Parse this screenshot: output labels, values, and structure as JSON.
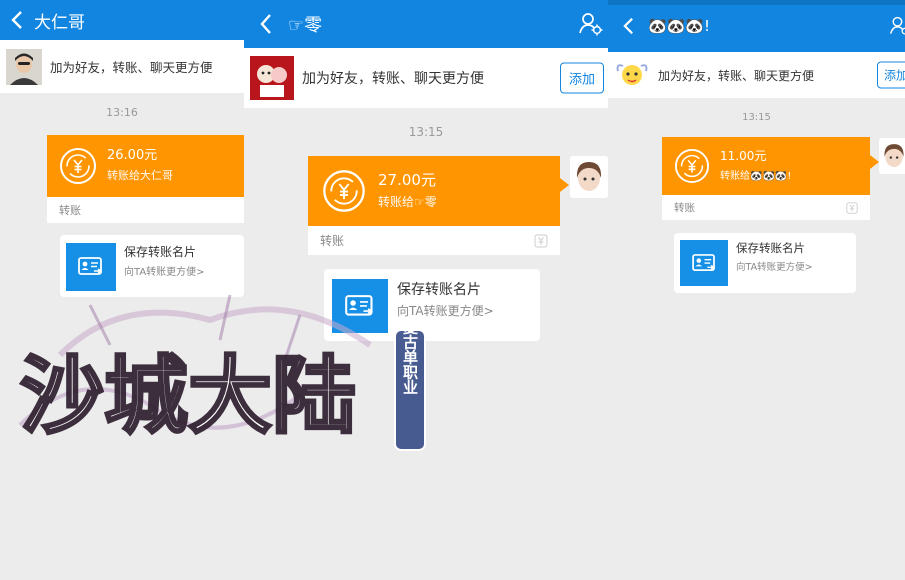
{
  "panels": [
    {
      "title": "大仁哥",
      "friend_prompt": "加为好友，转账、聊天更方便",
      "time": "13:16",
      "transfer": {
        "amount": "26.00元",
        "to": "转账给大仁哥",
        "label": "转账"
      },
      "save_card": {
        "title": "保存转账名片",
        "subtitle": "向TA转账更方便>"
      }
    },
    {
      "title": "☞零",
      "friend_prompt": "加为好友，转账、聊天更方便",
      "add_label": "添加",
      "time": "13:15",
      "transfer": {
        "amount": "27.00元",
        "to": "转账给☞零",
        "label": "转账"
      },
      "save_card": {
        "title": "保存转账名片",
        "subtitle": "向TA转账更方便>"
      }
    },
    {
      "title": "🐼🐼🐼!",
      "friend_prompt": "加为好友，转账、聊天更方便",
      "add_label": "添加",
      "time": "13:15",
      "transfer": {
        "amount": "11.00元",
        "to": "转账给🐼🐼🐼!",
        "label": "转账"
      },
      "save_card": {
        "title": "保存转账名片",
        "subtitle": "向TA转账更方便>"
      }
    }
  ],
  "watermark": {
    "title": "沙城大陆",
    "tag": "复古单职业"
  },
  "colors": {
    "titlebar": "#1185e0",
    "transfer": "#ff9500",
    "card_icon": "#1590e6",
    "background": "#ececec"
  }
}
